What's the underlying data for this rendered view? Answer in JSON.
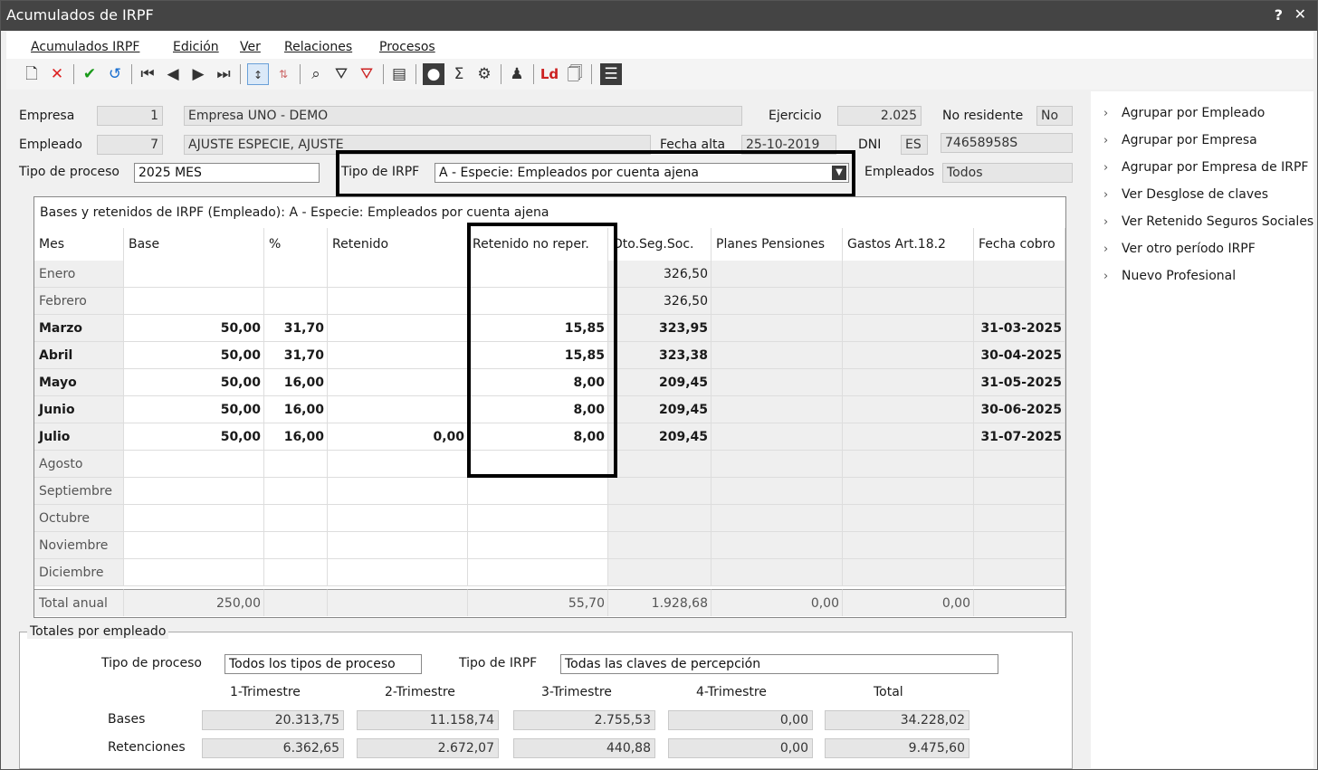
{
  "window": {
    "title": "Acumulados de IRPF",
    "help": "?",
    "close": "✕"
  },
  "menu": [
    "Acumulados IRPF",
    "Edición",
    "Ver",
    "Relaciones",
    "Procesos"
  ],
  "toolbar": [
    "new-icon",
    "delete-icon",
    "confirm-icon",
    "undo-icon",
    "first-icon",
    "prev-icon",
    "next-icon",
    "last-icon",
    "sort-asc-icon",
    "sort-desc-icon",
    "search-icon",
    "filter-icon",
    "clear-filter-icon",
    "grid-icon",
    "user-icon",
    "sum-icon",
    "recalc-icon",
    "person-icon",
    "ld-icon",
    "document-icon",
    "sheet-icon"
  ],
  "form": {
    "empresa_label": "Empresa",
    "empresa_code": "1",
    "empresa_name": "Empresa UNO - DEMO",
    "ejercicio_label": "Ejercicio",
    "ejercicio": "2.025",
    "no_residente_label": "No residente",
    "no_residente": "No",
    "empleado_label": "Empleado",
    "empleado_code": "7",
    "empleado_name": "AJUSTE ESPECIE, AJUSTE",
    "fecha_alta_label": "Fecha alta",
    "fecha_alta": "25-10-2019",
    "dni_label": "DNI",
    "dni_country": "ES",
    "dni": "74658958S",
    "tipo_proceso_label": "Tipo de proceso",
    "tipo_proceso": "2025 MES",
    "tipo_irpf_label": "Tipo de IRPF",
    "tipo_irpf": "A - Especie: Empleados por cuenta ajena",
    "empleados_label": "Empleados",
    "empleados": "Todos"
  },
  "grid": {
    "caption": "Bases y retenidos de IRPF (Empleado): A - Especie: Empleados por cuenta ajena",
    "headers": [
      "Mes",
      "Base",
      "%",
      "Retenido",
      "Retenido no reper.",
      "Dto.Seg.Soc.",
      "Planes Pensiones",
      "Gastos Art.18.2",
      "Fecha cobro"
    ],
    "rows": [
      {
        "mes": "Enero",
        "base": "",
        "pct": "",
        "ret": "",
        "retnr": "",
        "dto": "326,50",
        "planes": "",
        "gastos": "",
        "fecha": "",
        "bold": false
      },
      {
        "mes": "Febrero",
        "base": "",
        "pct": "",
        "ret": "",
        "retnr": "",
        "dto": "326,50",
        "planes": "",
        "gastos": "",
        "fecha": "",
        "bold": false
      },
      {
        "mes": "Marzo",
        "base": "50,00",
        "pct": "31,70",
        "ret": "",
        "retnr": "15,85",
        "dto": "323,95",
        "planes": "",
        "gastos": "",
        "fecha": "31-03-2025",
        "bold": true
      },
      {
        "mes": "Abril",
        "base": "50,00",
        "pct": "31,70",
        "ret": "",
        "retnr": "15,85",
        "dto": "323,38",
        "planes": "",
        "gastos": "",
        "fecha": "30-04-2025",
        "bold": true
      },
      {
        "mes": "Mayo",
        "base": "50,00",
        "pct": "16,00",
        "ret": "",
        "retnr": "8,00",
        "dto": "209,45",
        "planes": "",
        "gastos": "",
        "fecha": "31-05-2025",
        "bold": true
      },
      {
        "mes": "Junio",
        "base": "50,00",
        "pct": "16,00",
        "ret": "",
        "retnr": "8,00",
        "dto": "209,45",
        "planes": "",
        "gastos": "",
        "fecha": "30-06-2025",
        "bold": true
      },
      {
        "mes": "Julio",
        "base": "50,00",
        "pct": "16,00",
        "ret": "0,00",
        "retnr": "8,00",
        "dto": "209,45",
        "planes": "",
        "gastos": "",
        "fecha": "31-07-2025",
        "bold": true
      },
      {
        "mes": "Agosto",
        "base": "",
        "pct": "",
        "ret": "",
        "retnr": "",
        "dto": "",
        "planes": "",
        "gastos": "",
        "fecha": "",
        "bold": false
      },
      {
        "mes": "Septiembre",
        "base": "",
        "pct": "",
        "ret": "",
        "retnr": "",
        "dto": "",
        "planes": "",
        "gastos": "",
        "fecha": "",
        "bold": false
      },
      {
        "mes": "Octubre",
        "base": "",
        "pct": "",
        "ret": "",
        "retnr": "",
        "dto": "",
        "planes": "",
        "gastos": "",
        "fecha": "",
        "bold": false
      },
      {
        "mes": "Noviembre",
        "base": "",
        "pct": "",
        "ret": "",
        "retnr": "",
        "dto": "",
        "planes": "",
        "gastos": "",
        "fecha": "",
        "bold": false
      },
      {
        "mes": "Diciembre",
        "base": "",
        "pct": "",
        "ret": "",
        "retnr": "",
        "dto": "",
        "planes": "",
        "gastos": "",
        "fecha": "",
        "bold": false
      }
    ],
    "total": {
      "mes": "Total anual",
      "base": "250,00",
      "pct": "",
      "ret": "",
      "retnr": "55,70",
      "dto": "1.928,68",
      "planes": "0,00",
      "gastos": "0,00",
      "fecha": ""
    }
  },
  "totales": {
    "title": "Totales por empleado",
    "tipo_proceso_label": "Tipo de proceso",
    "tipo_proceso": "Todos los tipos de proceso",
    "tipo_irpf_label": "Tipo de IRPF",
    "tipo_irpf": "Todas las claves de percepción",
    "cols": [
      "1-Trimestre",
      "2-Trimestre",
      "3-Trimestre",
      "4-Trimestre",
      "Total"
    ],
    "bases_label": "Bases",
    "bases": [
      "20.313,75",
      "11.158,74",
      "2.755,53",
      "0,00",
      "34.228,02"
    ],
    "ret_label": "Retenciones",
    "ret": [
      "6.362,65",
      "2.672,07",
      "440,88",
      "0,00",
      "9.475,60"
    ]
  },
  "side": [
    "Agrupar por Empleado",
    "Agrupar por Empresa",
    "Agrupar por Empresa de IRPF",
    "Ver Desglose de claves",
    "Ver Retenido Seguros Sociales",
    "Ver otro período IRPF",
    "Nuevo Profesional"
  ]
}
